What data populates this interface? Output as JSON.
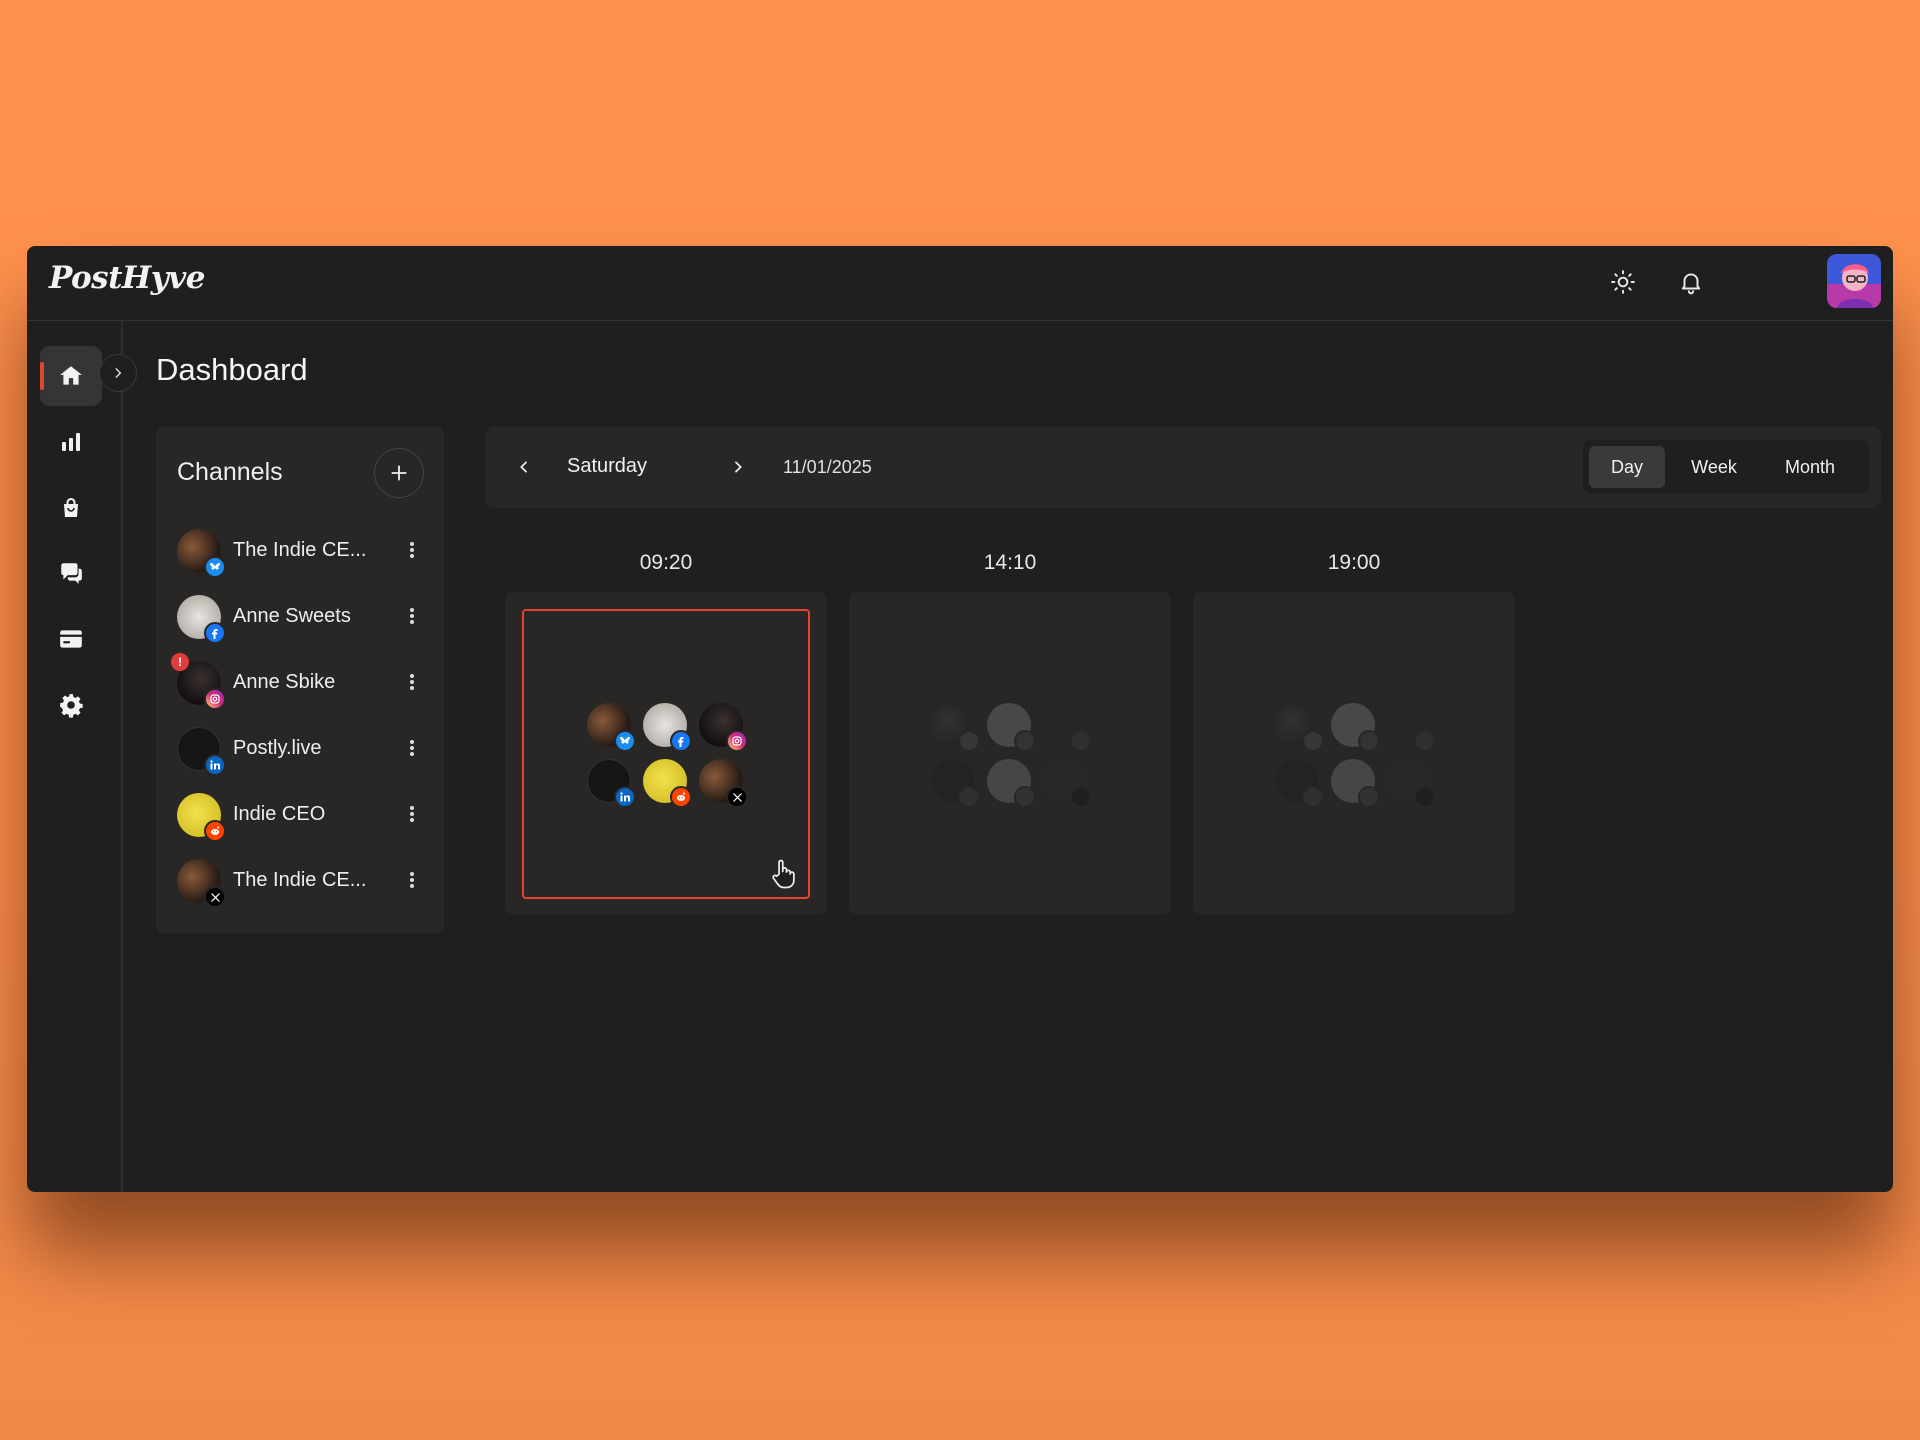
{
  "app": {
    "logo": "PostHyve"
  },
  "header": {
    "icons": [
      "sun-icon",
      "bell-icon"
    ]
  },
  "sidebar": {
    "items": [
      {
        "name": "home",
        "icon": "home-icon",
        "active": true
      },
      {
        "name": "analytics",
        "icon": "bar-chart-icon",
        "active": false
      },
      {
        "name": "shop",
        "icon": "shopping-bag-icon",
        "active": false
      },
      {
        "name": "messages",
        "icon": "chat-icon",
        "active": false
      },
      {
        "name": "billing",
        "icon": "credit-card-icon",
        "active": false
      },
      {
        "name": "settings",
        "icon": "gear-icon",
        "active": false
      }
    ]
  },
  "page": {
    "title": "Dashboard"
  },
  "channels": {
    "title": "Channels",
    "items": [
      {
        "name": "The Indie CE...",
        "network": "bluesky",
        "alert": false
      },
      {
        "name": "Anne Sweets",
        "network": "facebook",
        "alert": false
      },
      {
        "name": "Anne Sbike",
        "network": "instagram",
        "alert": true,
        "alert_text": "!"
      },
      {
        "name": "Postly.live",
        "network": "linkedin",
        "alert": false
      },
      {
        "name": "Indie CEO",
        "network": "reddit",
        "alert": false
      },
      {
        "name": "The Indie CE...",
        "network": "x",
        "alert": false
      }
    ]
  },
  "calendar": {
    "day": "Saturday",
    "date": "11/01/2025",
    "views": [
      "Day",
      "Week",
      "Month"
    ],
    "active_view": "Day",
    "slots": [
      {
        "time": "09:20",
        "selected": true
      },
      {
        "time": "14:10",
        "selected": false
      },
      {
        "time": "19:00",
        "selected": false
      }
    ]
  },
  "colors": {
    "accent": "#e0452d",
    "bluesky": "#1a8cf0",
    "facebook": "#1877f2",
    "instagram": "#e1306c",
    "linkedin": "#0a66c2",
    "reddit": "#ff4500",
    "x": "#000000"
  }
}
